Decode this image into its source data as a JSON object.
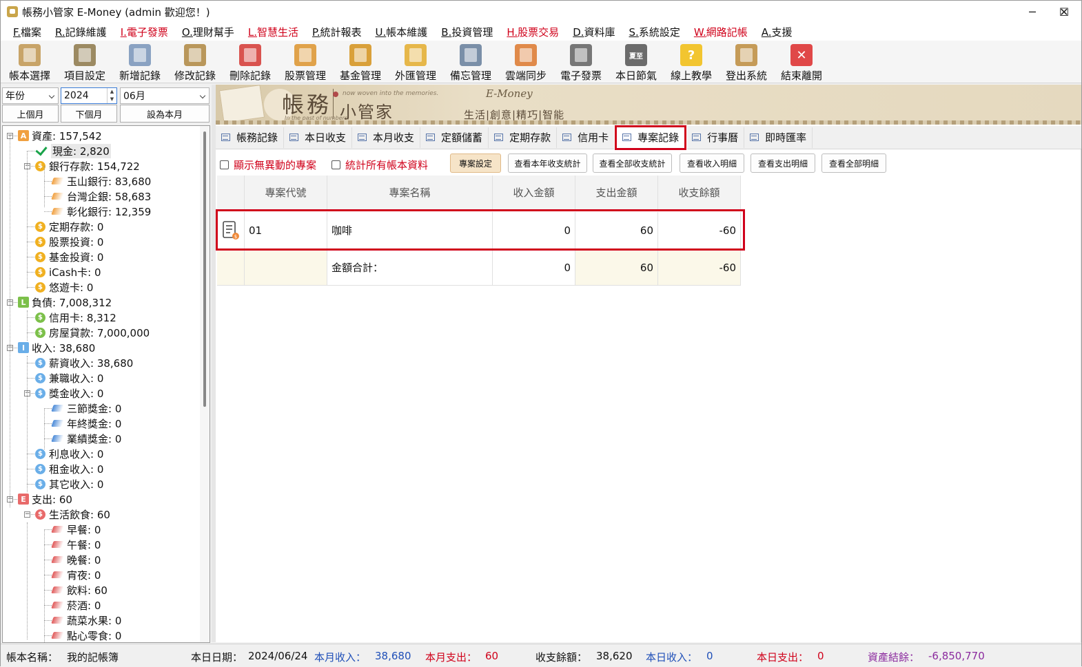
{
  "window": {
    "title": "帳務小管家 E-Money (admin 歡迎您！)",
    "min_glyph": "─",
    "max_glyph": "☐",
    "close_glyph": "✕"
  },
  "menu": [
    {
      "key": "F.",
      "label": "檔案",
      "red": false
    },
    {
      "key": "R.",
      "label": "記錄維護",
      "red": false
    },
    {
      "key": "I.",
      "label": "電子發票",
      "red": true
    },
    {
      "key": "O.",
      "label": "理財幫手",
      "red": false
    },
    {
      "key": "L.",
      "label": "智慧生活",
      "red": true
    },
    {
      "key": "P.",
      "label": "統計報表",
      "red": false
    },
    {
      "key": "U.",
      "label": "帳本維護",
      "red": false
    },
    {
      "key": "B.",
      "label": "投資管理",
      "red": false
    },
    {
      "key": "H.",
      "label": "股票交易",
      "red": true
    },
    {
      "key": "D.",
      "label": "資料庫",
      "red": false
    },
    {
      "key": "S.",
      "label": "系統設定",
      "red": false
    },
    {
      "key": "W.",
      "label": "網路記帳",
      "red": true
    },
    {
      "key": "A.",
      "label": "支援",
      "red": false
    }
  ],
  "toolbar": [
    {
      "label": "帳本選擇",
      "icon": "ledger-book-icon",
      "color": "#c8a468"
    },
    {
      "label": "項目設定",
      "icon": "gear-doc-icon",
      "color": "#9c8a62"
    },
    {
      "label": "新增記錄",
      "icon": "add-doc-icon",
      "color": "#8aa2c2"
    },
    {
      "label": "修改記錄",
      "icon": "edit-doc-icon",
      "color": "#b9975b"
    },
    {
      "label": "刪除記錄",
      "icon": "delete-doc-icon",
      "color": "#d9534f"
    },
    {
      "label": "股票管理",
      "icon": "stock-chart-icon",
      "color": "#e0a24a"
    },
    {
      "label": "基金管理",
      "icon": "fund-house-icon",
      "color": "#d9a03a"
    },
    {
      "label": "外匯管理",
      "icon": "coin-hand-icon",
      "color": "#e6b74a"
    },
    {
      "label": "備忘管理",
      "icon": "memo-clipboard-icon",
      "color": "#7a8fa8"
    },
    {
      "label": "雲端同步",
      "icon": "cloud-sync-icon",
      "color": "#e08a4a"
    },
    {
      "label": "電子發票",
      "icon": "qr-code-icon",
      "color": "#777777"
    },
    {
      "label": "本日節氣",
      "icon": "solar-term-icon",
      "color": "#6b6b6b",
      "text": "夏至"
    },
    {
      "label": "線上教學",
      "icon": "help-question-icon",
      "color": "#f2c530",
      "text": "?"
    },
    {
      "label": "登出系統",
      "icon": "user-logout-icon",
      "color": "#c59b58"
    },
    {
      "label": "結束離開",
      "icon": "exit-close-icon",
      "color": "#e04848",
      "text": "✕"
    }
  ],
  "period": {
    "year_mode": "年份",
    "year": "2024",
    "month": "06月",
    "prev": "上個月",
    "next": "下個月",
    "current": "設為本月"
  },
  "tree": [
    {
      "lvl": 0,
      "label": "資產: 157,542",
      "badge": "A",
      "color": "#f0a040",
      "shape": "sq",
      "exp": "−"
    },
    {
      "lvl": 1,
      "label": "現金: 2,820",
      "shape": "check",
      "selected": true
    },
    {
      "lvl": 1,
      "label": "銀行存款: 154,722",
      "badge": "$",
      "color": "#f0b020",
      "shape": "co",
      "exp": "−"
    },
    {
      "lvl": 2,
      "label": "玉山銀行: 83,680",
      "color": "#f0a040",
      "shape": "leaf"
    },
    {
      "lvl": 2,
      "label": "台灣企銀: 58,683",
      "color": "#f0a040",
      "shape": "leaf"
    },
    {
      "lvl": 2,
      "label": "彰化銀行: 12,359",
      "color": "#f0a040",
      "shape": "leaf"
    },
    {
      "lvl": 1,
      "label": "定期存款: 0",
      "badge": "$",
      "color": "#f0b020",
      "shape": "co"
    },
    {
      "lvl": 1,
      "label": "股票投資: 0",
      "badge": "$",
      "color": "#f0b020",
      "shape": "co"
    },
    {
      "lvl": 1,
      "label": "基金投資: 0",
      "badge": "$",
      "color": "#f0b020",
      "shape": "co"
    },
    {
      "lvl": 1,
      "label": "iCash卡: 0",
      "badge": "$",
      "color": "#f0b020",
      "shape": "co"
    },
    {
      "lvl": 1,
      "label": "悠遊卡: 0",
      "badge": "$",
      "color": "#f0b020",
      "shape": "co"
    },
    {
      "lvl": 0,
      "label": "負債: 7,008,312",
      "badge": "L",
      "color": "#7cc04a",
      "shape": "sq",
      "exp": "−"
    },
    {
      "lvl": 1,
      "label": "信用卡: 8,312",
      "badge": "$",
      "color": "#7cc04a",
      "shape": "co"
    },
    {
      "lvl": 1,
      "label": "房屋貸款: 7,000,000",
      "badge": "$",
      "color": "#7cc04a",
      "shape": "co"
    },
    {
      "lvl": 0,
      "label": "收入: 38,680",
      "badge": "I",
      "color": "#6aaee8",
      "shape": "sq",
      "exp": "−"
    },
    {
      "lvl": 1,
      "label": "薪資收入: 38,680",
      "badge": "$",
      "color": "#6aaee8",
      "shape": "co"
    },
    {
      "lvl": 1,
      "label": "兼職收入: 0",
      "badge": "$",
      "color": "#6aaee8",
      "shape": "co"
    },
    {
      "lvl": 1,
      "label": "獎金收入: 0",
      "badge": "$",
      "color": "#6aaee8",
      "shape": "co",
      "exp": "−"
    },
    {
      "lvl": 2,
      "label": "三節獎金: 0",
      "color": "#4a8ad8",
      "shape": "leaf"
    },
    {
      "lvl": 2,
      "label": "年終獎金: 0",
      "color": "#4a8ad8",
      "shape": "leaf"
    },
    {
      "lvl": 2,
      "label": "業績獎金: 0",
      "color": "#4a8ad8",
      "shape": "leaf"
    },
    {
      "lvl": 1,
      "label": "利息收入: 0",
      "badge": "$",
      "color": "#6aaee8",
      "shape": "co"
    },
    {
      "lvl": 1,
      "label": "租金收入: 0",
      "badge": "$",
      "color": "#6aaee8",
      "shape": "co"
    },
    {
      "lvl": 1,
      "label": "其它收入: 0",
      "badge": "$",
      "color": "#6aaee8",
      "shape": "co"
    },
    {
      "lvl": 0,
      "label": "支出: 60",
      "badge": "E",
      "color": "#e86a6a",
      "shape": "sq",
      "exp": "−"
    },
    {
      "lvl": 1,
      "label": "生活飲食: 60",
      "badge": "$",
      "color": "#e86a6a",
      "shape": "co",
      "exp": "−"
    },
    {
      "lvl": 2,
      "label": "早餐: 0",
      "color": "#e05a5a",
      "shape": "leaf"
    },
    {
      "lvl": 2,
      "label": "午餐: 0",
      "color": "#e05a5a",
      "shape": "leaf"
    },
    {
      "lvl": 2,
      "label": "晚餐: 0",
      "color": "#e05a5a",
      "shape": "leaf"
    },
    {
      "lvl": 2,
      "label": "宵夜: 0",
      "color": "#e05a5a",
      "shape": "leaf"
    },
    {
      "lvl": 2,
      "label": "飲料: 60",
      "color": "#e05a5a",
      "shape": "leaf"
    },
    {
      "lvl": 2,
      "label": "菸酒: 0",
      "color": "#e05a5a",
      "shape": "leaf"
    },
    {
      "lvl": 2,
      "label": "蔬菜水果: 0",
      "color": "#e05a5a",
      "shape": "leaf"
    },
    {
      "lvl": 2,
      "label": "點心零食: 0",
      "color": "#e05a5a",
      "shape": "leaf"
    }
  ],
  "banner": {
    "title1": "帳務",
    "title2": "小管家",
    "brand": "E-Money",
    "tagline_top": "now woven into the memories.",
    "tagline_bottom": "In the past of numbers.",
    "motto": "生活|創意|精巧|智能"
  },
  "tabs": [
    "帳務記錄",
    "本日收支",
    "本月收支",
    "定額儲蓄",
    "定期存款",
    "信用卡",
    "專案記錄",
    "行事曆",
    "即時匯率"
  ],
  "active_tab": "專案記錄",
  "options": {
    "show_inactive": "顯示無異動的專案",
    "all_books": "統計所有帳本資料"
  },
  "actions": {
    "project_settings": "專案設定",
    "year_stats": "查看本年收支統計",
    "all_stats": "查看全部收支統計",
    "income_detail": "查看收入明細",
    "expense_detail": "查看支出明細",
    "all_detail": "查看全部明細"
  },
  "grid": {
    "headers": [
      "專案代號",
      "專案名稱",
      "收入金額",
      "支出金額",
      "收支餘額"
    ],
    "rows": [
      {
        "code": "01",
        "name": "咖啡",
        "income": "0",
        "expense": "60",
        "balance": "-60"
      }
    ],
    "total": {
      "label": "金額合計：",
      "income": "0",
      "expense": "60",
      "balance": "-60"
    }
  },
  "status": {
    "book_label": "帳本名稱：",
    "book_name": "我的記帳簿",
    "date_label": "本日日期：",
    "date": "2024/06/24",
    "month_income_label": "本月收入：",
    "month_income": "38,680",
    "month_expense_label": "本月支出：",
    "month_expense": "60",
    "balance_label": "收支餘額：",
    "balance": "38,620",
    "day_income_label": "本日收入：",
    "day_income": "0",
    "day_expense_label": "本日支出：",
    "day_expense": "0",
    "asset_label": "資產結餘：",
    "asset": "-6,850,770"
  },
  "colors": {
    "accent_red": "#d0021b",
    "income_blue": "#1f4fb8",
    "asset_purple": "#8b2a9e"
  }
}
